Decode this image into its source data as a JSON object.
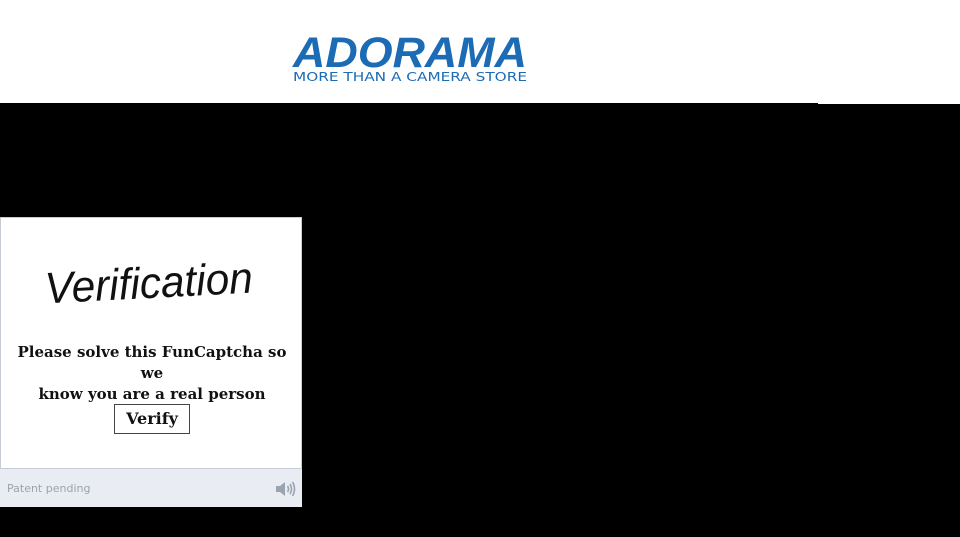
{
  "header": {
    "logo_text": "ADORAMA",
    "tagline": "MORE THAN A CAMERA STORE",
    "brand_color": "#1b6bb5"
  },
  "captcha": {
    "title_text": "Verification",
    "prompt_line1": "Please solve this FunCaptcha so",
    "prompt_line2": "we",
    "prompt_line3": "know you are a real person",
    "verify_label": "Verify",
    "footer_text": "Patent pending",
    "audio_icon": "speaker-icon"
  },
  "colors": {
    "page_background": "#000000",
    "footer_background": "#e9ecf2",
    "footer_text": "#9aa3b0"
  }
}
